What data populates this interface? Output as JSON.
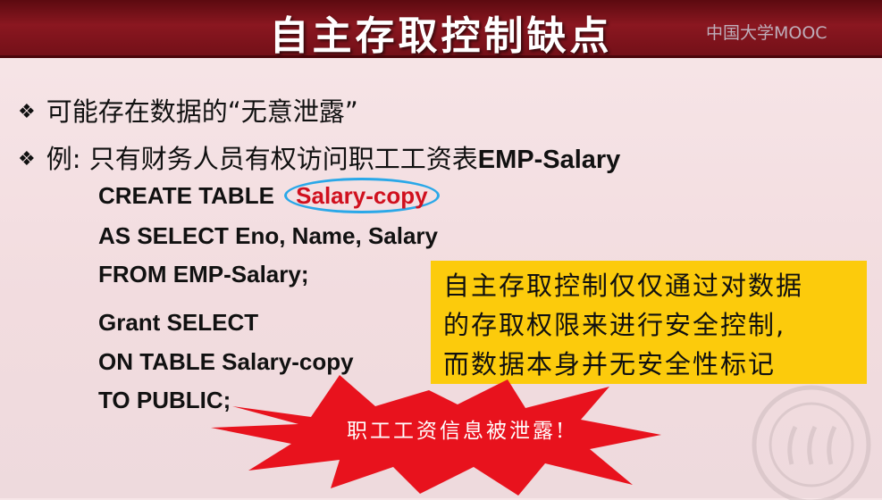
{
  "slide": {
    "title": "自主存取控制缺点",
    "watermark": "中国大学MOOC",
    "bullets": [
      {
        "text": "可能存在数据的“无意泄露”"
      },
      {
        "prefix": "例: 只有财务人员有权访问职工工资表",
        "strong": "EMP-Salary"
      }
    ],
    "code_lines": {
      "create_prefix": "CREATE TABLE",
      "create_target": "Salary-copy",
      "as_select": "AS SELECT  Eno, Name, Salary",
      "from": "FROM EMP-Salary;",
      "grant": "Grant SELECT",
      "on_table": "ON TABLE Salary-copy",
      "to_public": "TO PUBLIC;"
    },
    "note_lines": [
      "自主存取控制仅仅通过对数据",
      "的存取权限来进行安全控制,",
      "而数据本身并无安全性标记"
    ],
    "burst_text": "职工工资信息被泄露!"
  },
  "colors": {
    "title_bar": "#7a1119",
    "highlight_text": "#d0101e",
    "highlight_ring": "#2aa8e8",
    "note_bg": "#fccb0c",
    "burst": "#e8121d"
  }
}
